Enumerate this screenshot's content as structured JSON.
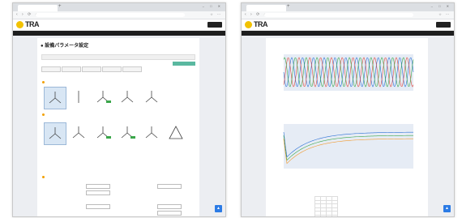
{
  "tabs": {
    "left": "",
    "right": ""
  },
  "addr": {
    "left": "",
    "right": ""
  },
  "brand": {
    "name": "TRA",
    "subtitle": ""
  },
  "left_page": {
    "title": "設備パラメータ設定",
    "sections": {
      "wiring": "",
      "wiring_sub": "",
      "settings": "",
      "settings_sub": ""
    }
  },
  "right_page": {
    "section_title": "",
    "chart1": {
      "title": ""
    },
    "chart2": {
      "title": ""
    },
    "table_title": ""
  },
  "chart_data": [
    {
      "type": "line",
      "title": "",
      "series": [
        {
          "values": []
        },
        {
          "values": []
        },
        {
          "values": []
        }
      ]
    },
    {
      "type": "line",
      "title": "",
      "series": [
        {
          "values": []
        },
        {
          "values": []
        },
        {
          "values": []
        }
      ]
    }
  ],
  "colors": {
    "brand_yellow": "#f2c200",
    "nav_dark": "#1e1e1e",
    "accent_blue": "#2c7be5",
    "series_blue": "#2a6fd6",
    "series_green": "#3aa64a",
    "series_red": "#e0493e",
    "series_orange": "#f29a2e"
  }
}
